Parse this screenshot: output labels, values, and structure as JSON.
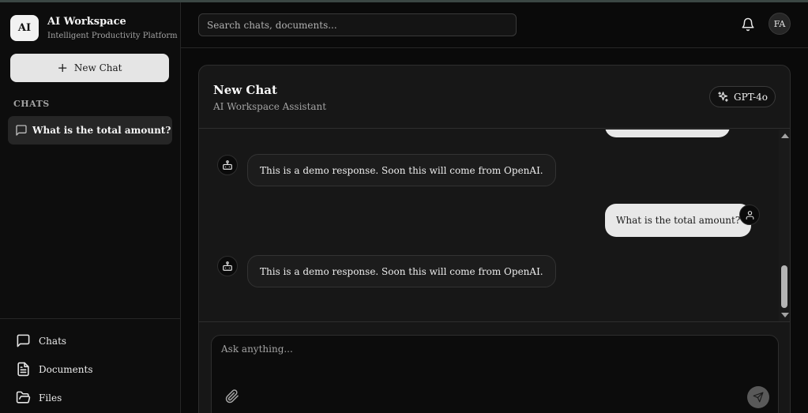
{
  "brand": {
    "logo_text": "AI",
    "title": "AI Workspace",
    "subtitle": "Intelligent Productivity Platform"
  },
  "sidebar": {
    "new_chat_label": "New Chat",
    "section_label": "CHATS",
    "chats": [
      {
        "label": "What is the total amount?",
        "icon": "message-square-icon",
        "active": true
      }
    ],
    "nav": [
      {
        "label": "Chats",
        "icon": "message-square-icon"
      },
      {
        "label": "Documents",
        "icon": "file-text-icon"
      },
      {
        "label": "Files",
        "icon": "folder-open-icon"
      }
    ]
  },
  "header": {
    "search_placeholder": "Search chats, documents...",
    "notification_icon": "bell-icon",
    "user_initials": "FA"
  },
  "chat": {
    "title": "New Chat",
    "subtitle": "AI Workspace Assistant",
    "model_label": "GPT-4o",
    "messages": [
      {
        "role": "assistant",
        "text": "This is a demo response. Soon this will come from OpenAI."
      },
      {
        "role": "user",
        "text": "What is the total amount?"
      },
      {
        "role": "assistant",
        "text": "This is a demo response. Soon this will come from OpenAI."
      }
    ],
    "composer_placeholder": "Ask anything..."
  },
  "colors": {
    "background": "#0a0a0a",
    "card": "#171717",
    "accent_light": "#e5e5e5",
    "border": "#2e2e2e"
  }
}
